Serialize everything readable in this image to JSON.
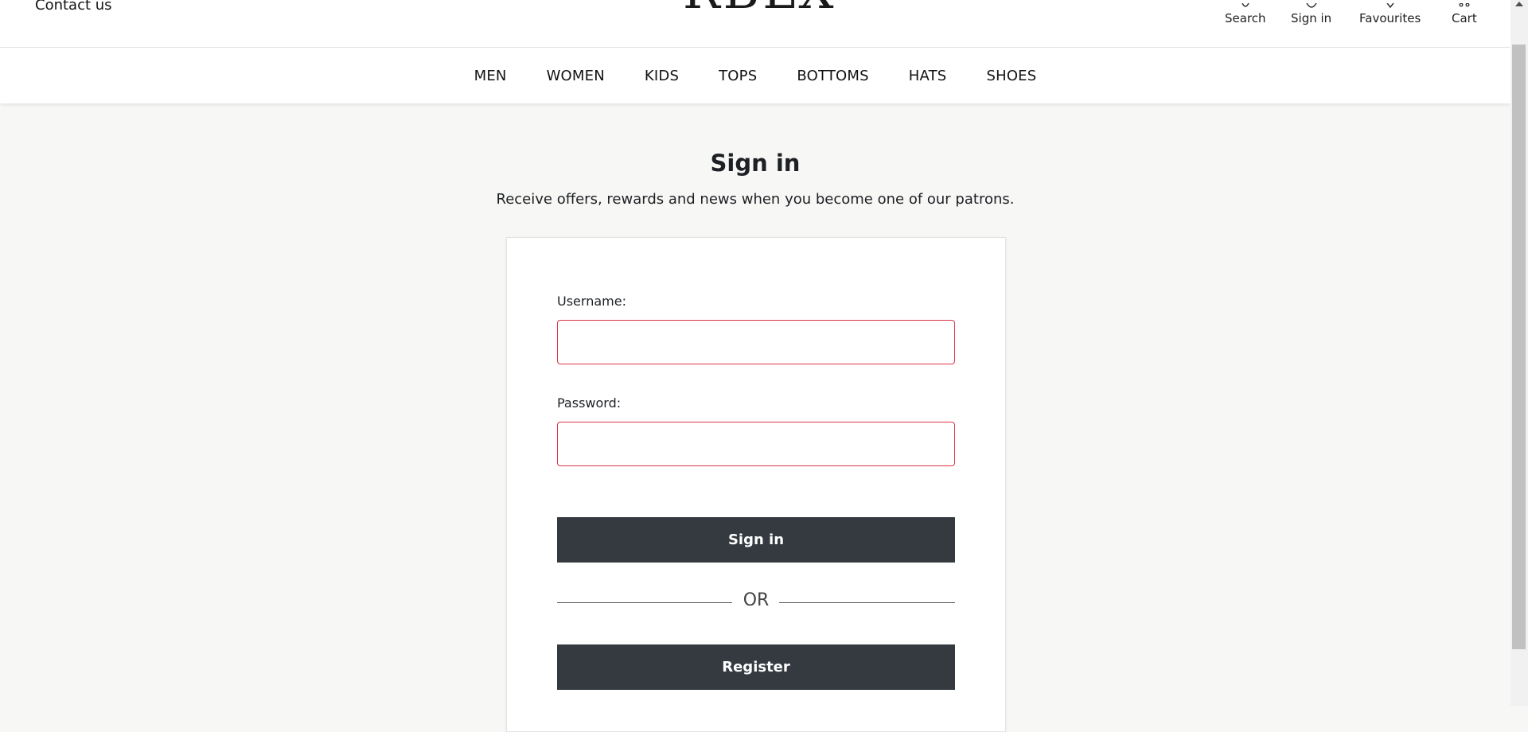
{
  "header": {
    "contact_label": "Contact us",
    "logo_text": "RBLX",
    "links": {
      "search": "Search",
      "sign_in": "Sign in",
      "favourites": "Favourites",
      "cart": "Cart"
    }
  },
  "nav": {
    "items": [
      "MEN",
      "WOMEN",
      "KIDS",
      "TOPS",
      "BOTTOMS",
      "HATS",
      "SHOES"
    ]
  },
  "page": {
    "title": "Sign in",
    "subtitle": "Receive offers, rewards and news when you become one of our patrons."
  },
  "form": {
    "username_label": "Username:",
    "username_value": "",
    "password_label": "Password:",
    "password_value": "",
    "sign_in_button": "Sign in",
    "or_label": "OR",
    "register_button": "Register"
  },
  "colors": {
    "button_bg": "#343a40",
    "invalid_border": "#dc3545",
    "page_bg": "#f7f7f5"
  }
}
